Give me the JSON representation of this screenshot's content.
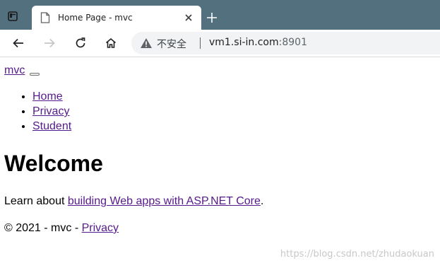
{
  "browser": {
    "tab": {
      "title": "Home Page - mvc"
    },
    "address_bar": {
      "security_label": "不安全",
      "url_host": "vm1.si-in.com",
      "url_port": ":8901"
    },
    "colors": {
      "tabbar": "#53707f",
      "omnibox": "#f1f3f4"
    }
  },
  "page": {
    "brand": "mvc",
    "nav": [
      {
        "label": "Home"
      },
      {
        "label": "Privacy"
      },
      {
        "label": "Student"
      }
    ],
    "heading": "Welcome",
    "learn": {
      "prefix": "Learn about ",
      "link": "building Web apps with ASP.NET Core",
      "suffix": "."
    },
    "footer": {
      "text": "© 2021 - mvc - ",
      "link": "Privacy"
    },
    "link_color": "#551a8b"
  },
  "watermark": "https://blog.csdn.net/zhudaokuan"
}
